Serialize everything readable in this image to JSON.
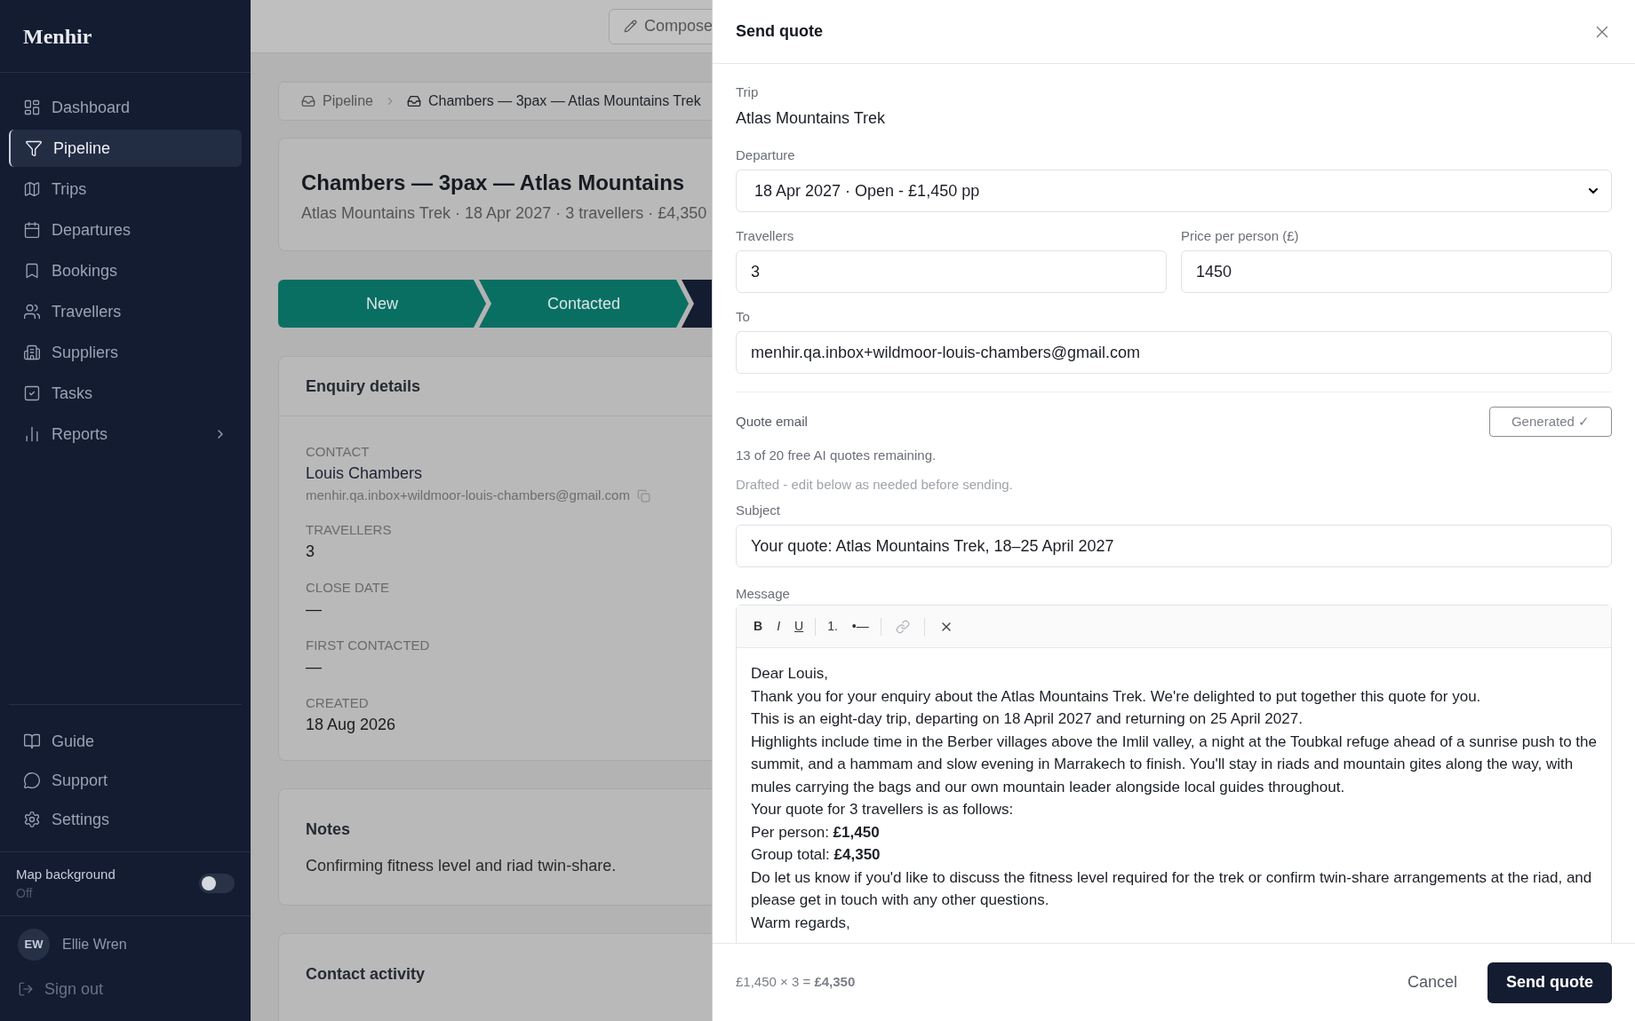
{
  "sidebar": {
    "logo": "Menhir",
    "items": [
      {
        "label": "Dashboard",
        "selected": false
      },
      {
        "label": "Pipeline",
        "selected": true
      },
      {
        "label": "Trips",
        "selected": false
      },
      {
        "label": "Departures",
        "selected": false
      },
      {
        "label": "Bookings",
        "selected": false
      },
      {
        "label": "Travellers",
        "selected": false
      },
      {
        "label": "Suppliers",
        "selected": false
      },
      {
        "label": "Tasks",
        "selected": false
      },
      {
        "label": "Reports",
        "selected": false,
        "has_submenu": true
      }
    ],
    "bottom_items": [
      {
        "label": "Guide"
      },
      {
        "label": "Support"
      },
      {
        "label": "Settings"
      }
    ],
    "map_background": {
      "label": "Map background",
      "state_text": "Off",
      "on": false
    },
    "user": {
      "initials": "EW",
      "name": "Ellie Wren"
    },
    "sign_out": "Sign out"
  },
  "topbar": {
    "compose": "Compose"
  },
  "breadcrumb": [
    "Pipeline",
    "Chambers — 3pax — Atlas Mountains Trek"
  ],
  "deal": {
    "title": "Chambers — 3pax — Atlas Mountains",
    "subtitle": "Atlas Mountains Trek · 18 Apr 2027 · 3 travellers · £4,350"
  },
  "stages": [
    {
      "label": "New",
      "completed": true
    },
    {
      "label": "Contacted",
      "completed": true
    },
    {
      "completed": false
    }
  ],
  "enquiry": {
    "title": "Enquiry details",
    "fields": [
      {
        "label": "CONTACT",
        "value": "Louis Chambers",
        "email": "menhir.qa.inbox+wildmoor-louis-chambers@gmail.com"
      },
      {
        "label": "TRAVELLERS",
        "value": "3"
      },
      {
        "label": "CLOSE DATE",
        "value": "—"
      },
      {
        "label": "FIRST CONTACTED",
        "value": "—"
      },
      {
        "label": "CREATED",
        "value": "18 Aug 2026"
      }
    ]
  },
  "notes": {
    "title": "Notes",
    "text": "Confirming fitness level and riad twin-share."
  },
  "contact_activity": {
    "title": "Contact activity"
  },
  "drawer": {
    "title": "Send quote",
    "trip": {
      "label": "Trip",
      "value": "Atlas Mountains Trek"
    },
    "departure": {
      "label": "Departure",
      "value": "18 Apr 2027 · Open - £1,450 pp"
    },
    "travellers": {
      "label": "Travellers",
      "value": "3"
    },
    "price": {
      "label": "Price per person (£)",
      "value": "1450"
    },
    "to": {
      "label": "To",
      "value": "menhir.qa.inbox+wildmoor-louis-chambers@gmail.com"
    },
    "quote_email": {
      "label": "Quote email",
      "button": "Generated ✓",
      "remaining": "13 of 20 free AI quotes remaining.",
      "hint": "Drafted - edit below as needed before sending."
    },
    "subject": {
      "label": "Subject",
      "value": "Your quote: Atlas Mountains Trek, 18–25 April 2027"
    },
    "message": {
      "label": "Message",
      "toolbar": [
        {
          "kind": "text",
          "label": "B"
        },
        {
          "kind": "text",
          "label": "I"
        },
        {
          "kind": "text",
          "label": "U"
        },
        {
          "kind": "divider"
        },
        {
          "kind": "text",
          "label": "1."
        },
        {
          "kind": "text",
          "label": "•—"
        },
        {
          "kind": "divider"
        },
        {
          "kind": "icon",
          "disabled": true
        },
        {
          "kind": "divider"
        },
        {
          "kind": "icon",
          "disabled": false
        }
      ],
      "lines": [
        "Dear Louis,",
        "Thank you for your enquiry about the Atlas Mountains Trek. We're delighted to put together this quote for you.",
        "This is an eight-day trip, departing on 18 April 2027 and returning on 25 April 2027.",
        "Highlights include time in the Berber villages above the Imlil valley, a night at the Toubkal refuge ahead of a sunrise push to the summit, and a hammam and slow evening in Marrakech to finish. You'll stay in riads and mountain gites along the way, with mules carrying the bags and our own mountain leader alongside local guides throughout.",
        "Your quote for 3 travellers is as follows:",
        "Per person: **£1,450**",
        "Group total: **£4,350**",
        "Do let us know if you'd like to discuss the fitness level required for the trek or confirm twin-share arrangements at the riad, and please get in touch with any other questions.",
        "Warm regards,"
      ]
    },
    "summary": "£1,450 × 3 = **£4,350**",
    "cancel": "Cancel",
    "send": "Send quote"
  }
}
